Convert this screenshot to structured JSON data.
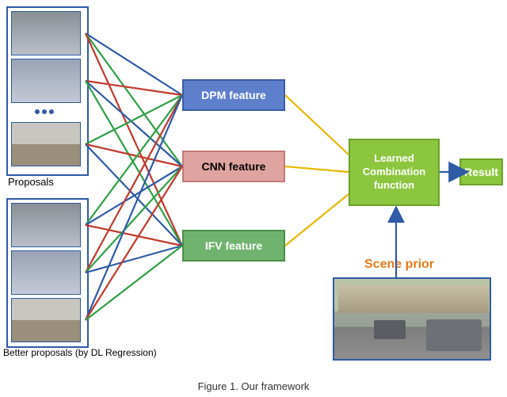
{
  "labels": {
    "proposals": "Proposals",
    "better_proposals": "Better proposals (by DL Regression)",
    "scene_prior": "Scene prior",
    "caption": "Figure 1. Our framework"
  },
  "feature_boxes": {
    "dpm": "DPM feature",
    "cnn": "CNN feature",
    "ifv": "IFV feature"
  },
  "combination": {
    "learned": "Learned Combination function",
    "result": "Result"
  },
  "chart_data": {
    "type": "diagram",
    "nodes": [
      {
        "id": "proposals",
        "label": "Proposals",
        "type": "image-stack"
      },
      {
        "id": "better_proposals",
        "label": "Better proposals (by DL Regression)",
        "type": "image-stack"
      },
      {
        "id": "dpm_feature",
        "label": "DPM feature",
        "color": "#5d7fcc"
      },
      {
        "id": "cnn_feature",
        "label": "CNN feature",
        "color": "#e0a4a0"
      },
      {
        "id": "ifv_feature",
        "label": "IFV feature",
        "color": "#70b36e"
      },
      {
        "id": "learned_combination",
        "label": "Learned Combination function",
        "color": "#8cc63f"
      },
      {
        "id": "result",
        "label": "Result",
        "color": "#8cc63f"
      },
      {
        "id": "scene_prior",
        "label": "Scene prior",
        "type": "image"
      }
    ],
    "edges": [
      {
        "from": "proposals",
        "to": "dpm_feature",
        "style": "multi-color"
      },
      {
        "from": "proposals",
        "to": "cnn_feature",
        "style": "multi-color"
      },
      {
        "from": "proposals",
        "to": "ifv_feature",
        "style": "multi-color"
      },
      {
        "from": "better_proposals",
        "to": "dpm_feature",
        "style": "multi-color"
      },
      {
        "from": "better_proposals",
        "to": "cnn_feature",
        "style": "multi-color"
      },
      {
        "from": "better_proposals",
        "to": "ifv_feature",
        "style": "multi-color"
      },
      {
        "from": "dpm_feature",
        "to": "learned_combination",
        "color": "#e6b800"
      },
      {
        "from": "cnn_feature",
        "to": "learned_combination",
        "color": "#e6b800"
      },
      {
        "from": "ifv_feature",
        "to": "learned_combination",
        "color": "#e6b800"
      },
      {
        "from": "scene_prior",
        "to": "learned_combination",
        "color": "#2e5aa6"
      },
      {
        "from": "learned_combination",
        "to": "result",
        "color": "#2e5aa6"
      }
    ]
  }
}
